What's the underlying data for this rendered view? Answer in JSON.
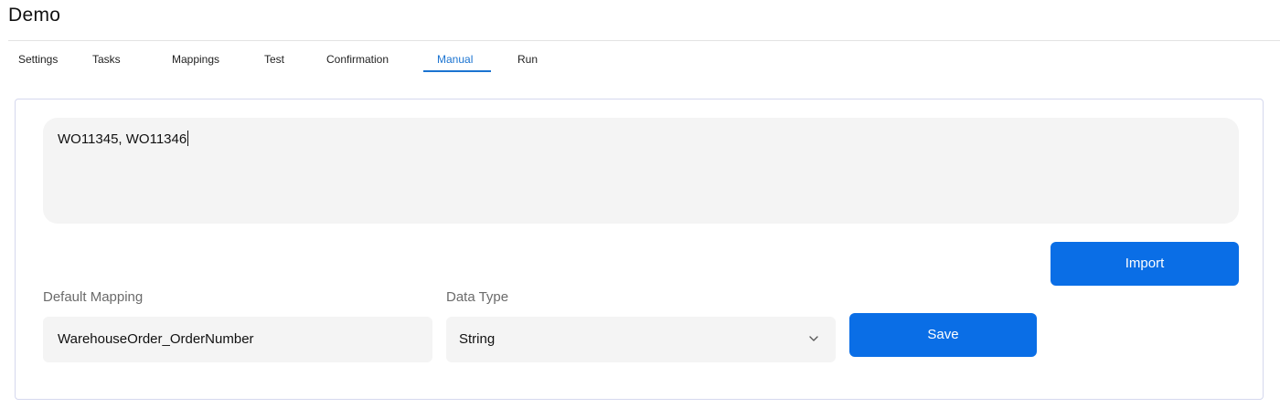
{
  "app": {
    "title": "Demo"
  },
  "tabs": [
    {
      "label": "Settings",
      "active": false
    },
    {
      "label": "Tasks",
      "active": false
    },
    {
      "label": "Mappings",
      "active": false
    },
    {
      "label": "Test",
      "active": false
    },
    {
      "label": "Confirmation",
      "active": false
    },
    {
      "label": "Manual",
      "active": true
    },
    {
      "label": "Run",
      "active": false
    }
  ],
  "manual": {
    "input_value": "WO11345, WO11346",
    "import_label": "Import",
    "default_mapping_label": "Default Mapping",
    "default_mapping_value": "WarehouseOrder_OrderNumber",
    "data_type_label": "Data Type",
    "data_type_value": "String",
    "save_label": "Save"
  },
  "colors": {
    "accent": "#0a6ee6",
    "tab_active": "#1a73d1",
    "field_background": "#f4f4f4",
    "card_border": "#d5d8ee"
  },
  "icons": {
    "select_chevron": "chevron-down-icon"
  }
}
